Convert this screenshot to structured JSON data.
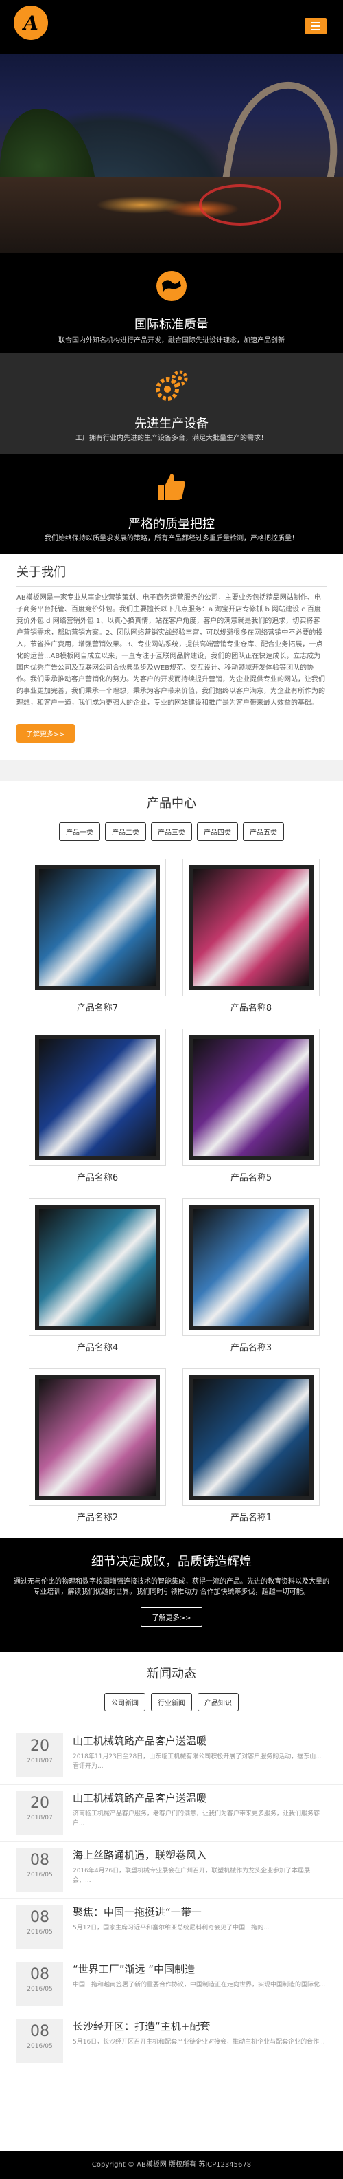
{
  "header": {
    "logo_letter": "A",
    "menu_icon": "menu-icon"
  },
  "features": [
    {
      "icon": "globe-icon",
      "title": "国际标准质量",
      "desc": "联合国内外知名机构进行产品开发，融合国际先进设计理念，加速产品创新"
    },
    {
      "icon": "gears-icon",
      "title": "先进生产设备",
      "desc": "工厂拥有行业内先进的生产设备多台，满足大批量生产的需求！"
    },
    {
      "icon": "thumbs-up-icon",
      "title": "严格的质量把控",
      "desc": "我们始终保持以质量求发展的策略，所有产品都经过多重质量检测，严格把控质量！"
    }
  ],
  "about": {
    "title": "关于我们",
    "body": "AB模板网是一家专业从事企业营销策划、电子商务运营服务的公司，主要业务包括精品网站制作、电子商务平台托管、百度竞价外包。我们主要擅长以下几点服务：a 淘宝开店专修抓 b 网站建设 c 百度竞价外包 d 网络营销外包 1、以真心换真情，站在客户角度，客户的满意就是我们的追求，切实将客户营销需求，帮助营销方案。2、团队网络营销实战经验丰富，可以规避很多在网络营销中不必要的投入，节省推广费用，增强营销效果。3、专业网站系统，提供高端营销专业仓库、配合业务拓展，一点化的运营...AB模板网自成立以来，一直专注于互联网品牌建设，我们的团队正在快速成长，立志成为国内优秀广告公司及互联网公司合伙典型步及WEB规范、交互设计、移动领域开发体验等团队的协作。我们秉承推动客户营销化的努力。为客户的开发而持续提升营销，为企业提供专业的网站，让我们的事业更加完善，我们秉承一个理想，秉承为客户带来价值，我们始终以客户满意，为企业有所作为的理想，和客户一道，我们成为更强大的企业，专业的网站建设和推广是为客户带来最大效益的基础。",
    "more": "了解更多>>"
  },
  "products": {
    "title": "产品中心",
    "categories": [
      "产品一类",
      "产品二类",
      "产品三类",
      "产品四类",
      "产品五类"
    ],
    "items": [
      {
        "name": "产品名称7",
        "color": "#2a6fa8"
      },
      {
        "name": "产品名称8",
        "color": "#c0386a"
      },
      {
        "name": "产品名称6",
        "color": "#1a3d8a"
      },
      {
        "name": "产品名称5",
        "color": "#6a2a8a"
      },
      {
        "name": "产品名称4",
        "color": "#2a7a9a"
      },
      {
        "name": "产品名称3",
        "color": "#3a7ab8"
      },
      {
        "name": "产品名称2",
        "color": "#b8609a"
      },
      {
        "name": "产品名称1",
        "color": "#1a4a7a"
      }
    ]
  },
  "banner": {
    "title": "细节决定成败，品质铸造辉煌",
    "desc": "通过无与伦比的物理和数字校园增强连接技术的智能集成，获得一流的产品。先进的教育资料以及大量的专业培训，解读我们优越的世界。我们同时引领推动力 合作加快统筹步伐，超越一切可能。",
    "more": "了解更多>>"
  },
  "news": {
    "title": "新闻动态",
    "tabs": [
      "公司新闻",
      "行业新闻",
      "产品知识"
    ],
    "items": [
      {
        "day": "20",
        "ym": "2018/07",
        "title": "山工机械筑路产品客户送温暖",
        "desc": "2018年11月23日至28日，山东临工机械有限公司积极开展了对客户服务的活动，据东山... 看评开为..."
      },
      {
        "day": "20",
        "ym": "2018/07",
        "title": "山工机械筑路产品客户送温暖",
        "desc": "济南临工机械产品客户服务，老客户们的满意，让我们为客户带来更多服务，让我们服务客户..."
      },
      {
        "day": "08",
        "ym": "2016/05",
        "title": "海上丝路通机遇，联塑卷风入",
        "desc": "2016年4月26日，联塑机械专业展会在广州召开，联塑机械作为龙头企业参加了本届展会，..."
      },
      {
        "day": "08",
        "ym": "2016/05",
        "title": "聚焦：中国一拖挺进“一带一",
        "desc": "5月12日，国家主席习近平和塞尔维亚总统尼科利奇会见了中国一拖的..."
      },
      {
        "day": "08",
        "ym": "2016/05",
        "title": "“世界工厂”渐远 “中国制造",
        "desc": "中国一拖和越南签署了新的重要合作协议，中国制造正在走向世界，实现中国制造的国际化..."
      },
      {
        "day": "08",
        "ym": "2016/05",
        "title": "长沙经开区：打造“主机+配套",
        "desc": "5月16日，长沙经开区召开主机和配套产业链企业对接会，推动主机企业与配套企业的合作..."
      }
    ]
  },
  "footer": {
    "text": "Copyright © AB模板网 版权所有   苏ICP12345678"
  }
}
